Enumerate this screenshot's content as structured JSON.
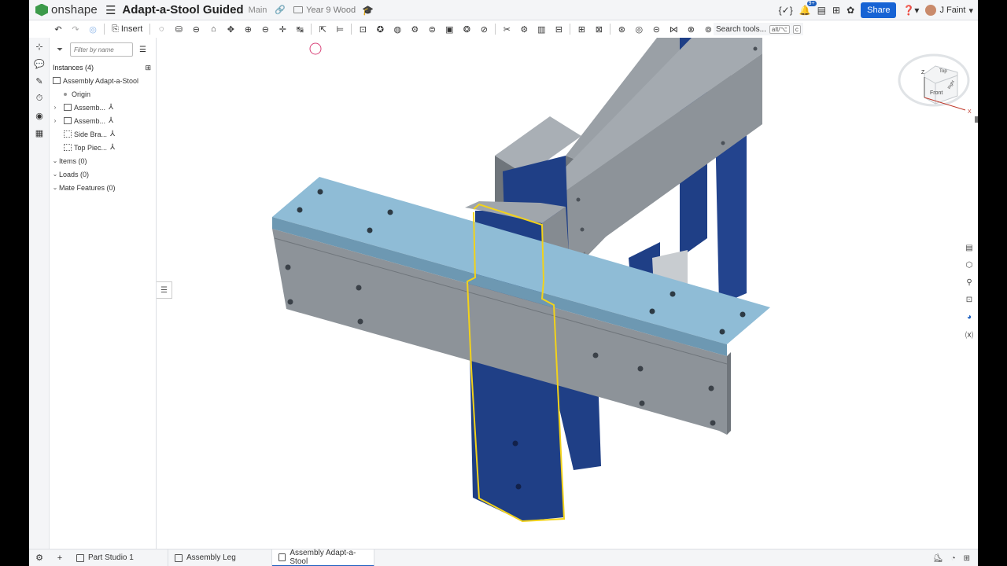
{
  "header": {
    "logo_text": "onshape",
    "doc_title": "Adapt-a-Stool Guided",
    "branch": "Main",
    "folder": "Year 9 Wood",
    "notifications_count": "9+",
    "share_label": "Share",
    "user_name": "J Faint"
  },
  "toolbar": {
    "insert_label": "Insert",
    "search_label": "Search tools...",
    "search_shortcut_1": "alt/⌥",
    "search_shortcut_2": "c"
  },
  "panel": {
    "filter_placeholder": "Filter by name",
    "instances_label": "Instances (4)",
    "tree": [
      {
        "label": "Assembly Adapt-a-Stool"
      },
      {
        "label": "Origin"
      },
      {
        "label": "Assemb..."
      },
      {
        "label": "Assemb..."
      },
      {
        "label": "Side Bra..."
      },
      {
        "label": "Top Piec..."
      }
    ],
    "sections": [
      {
        "label": "Items (0)"
      },
      {
        "label": "Loads (0)"
      },
      {
        "label": "Mate Features (0)"
      }
    ]
  },
  "viewcube": {
    "front": "Front",
    "top": "Top",
    "right": "Right",
    "axis_z": "Z",
    "axis_x": "X"
  },
  "tabs": [
    {
      "label": "Part Studio 1"
    },
    {
      "label": "Assembly Leg"
    },
    {
      "label": "Assembly Adapt-a-Stool"
    }
  ],
  "colors": {
    "accent": "#1763d4",
    "selected_part": "#8fbcd6",
    "blue_part": "#1f3f86",
    "grey_part": "#8d9399",
    "selection_outline": "#f2d21b"
  }
}
